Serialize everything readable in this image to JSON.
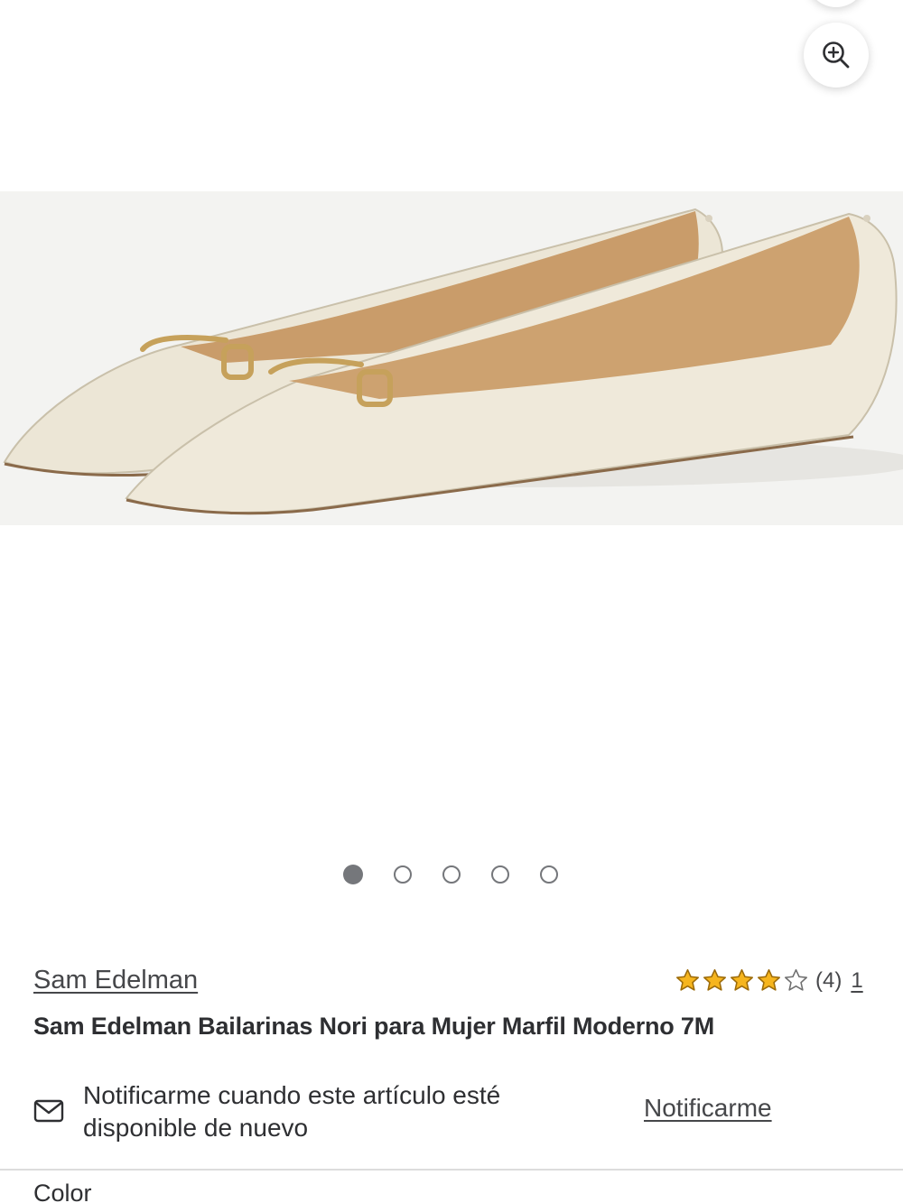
{
  "gallery": {
    "product_image_alt": "Sam Edelman Bailarinas Nori para Mujer Marfil Moderno 7M",
    "slide_count": 5,
    "active_slide": 1
  },
  "product": {
    "brand": "Sam Edelman",
    "title": "Sam Edelman Bailarinas Nori para Mujer Marfil Moderno 7M",
    "rating": {
      "stars_out_of_5": 4,
      "count_text": "(4)",
      "link_text": "1"
    }
  },
  "notify": {
    "message": "Notificarme cuando este artículo esté disponible de nuevo",
    "button_label": "Notificarme"
  },
  "options": {
    "color_label": "Color"
  },
  "colors": {
    "star_fill": "#f6b51e",
    "star_stroke": "#9c6b0b",
    "dot_active": "#75777b",
    "text_primary": "#2e2f32"
  },
  "icons": {
    "zoom": "zoom-in-icon",
    "mail": "mail-icon",
    "star": "star-icon"
  }
}
